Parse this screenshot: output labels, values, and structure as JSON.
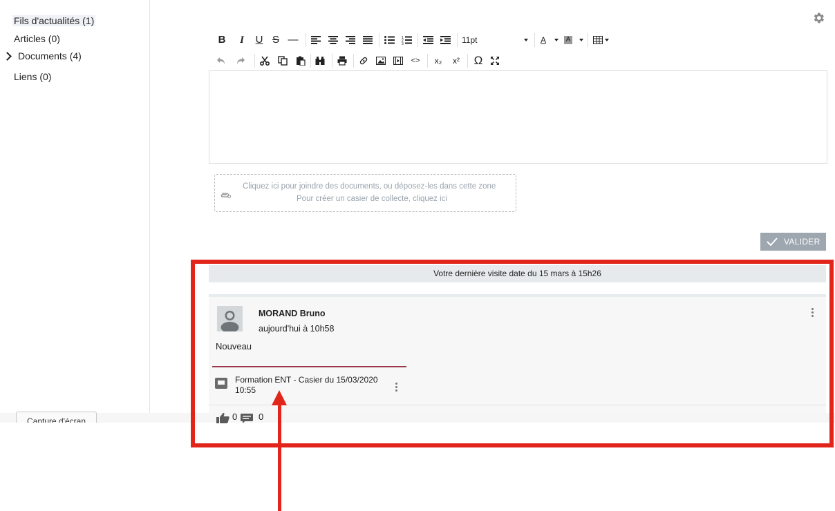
{
  "sidebar": {
    "items": [
      {
        "label": "Fils d'actualités (1)"
      },
      {
        "label": "Articles (0)"
      },
      {
        "label": "Documents (4)"
      },
      {
        "label": "Liens (0)"
      }
    ]
  },
  "toolbar": {
    "bold": "B",
    "italic": "I",
    "underline": "U",
    "strike": "S",
    "hr": "—",
    "font_size": "11pt",
    "text_color": "A",
    "bg_color": "A",
    "omega": "Ω",
    "subscript": "x₂",
    "superscript": "x²",
    "code": "<>"
  },
  "dropzone": {
    "line1": "Cliquez ici pour joindre des documents, ou déposez-les dans cette zone",
    "line2": "Pour créer un casier de collecte, cliquez ici"
  },
  "valider_label": "VALIDER",
  "last_visit": "Votre dernière visite date du 15 mars à 15h26",
  "post": {
    "author": "MORAND Bruno",
    "date": "aujourd'hui à 10h58",
    "text": "Nouveau",
    "attachment": "Formation ENT - Casier du 15/03/2020 10:55",
    "likes": "0",
    "comments": "0"
  },
  "capture_button": "Capture d'écran",
  "colors": {
    "annotation_red": "#e1251b",
    "attachment_bar": "#9b3a4f",
    "valider_bg": "#9ea7af"
  }
}
